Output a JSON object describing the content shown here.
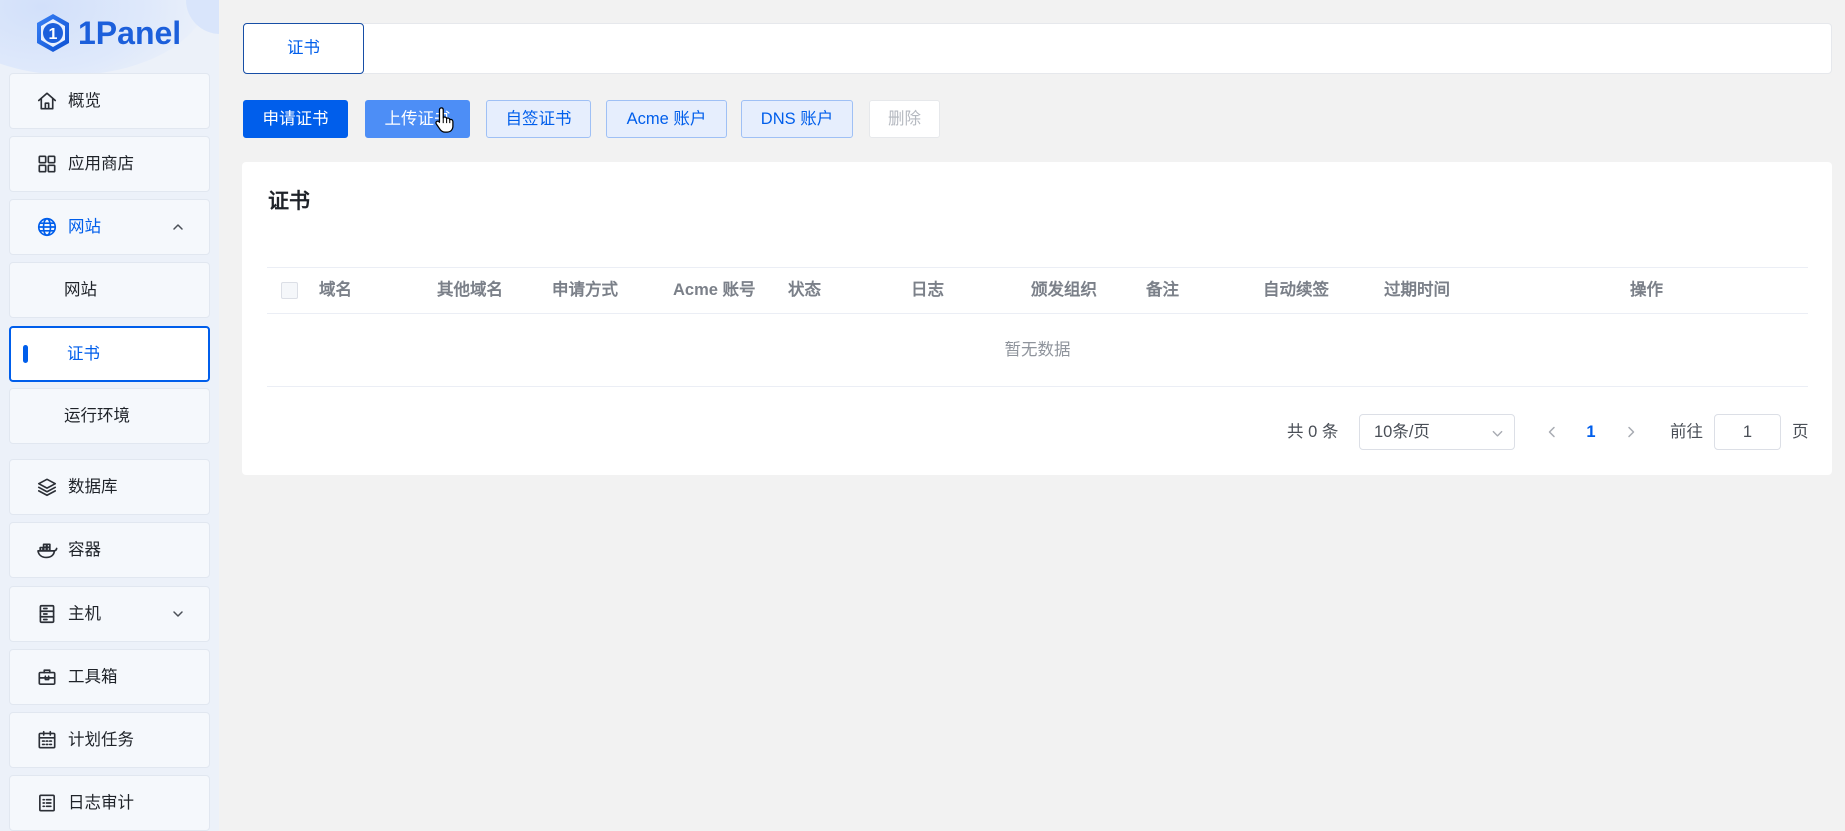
{
  "logo": {
    "mark": "1",
    "text": "1Panel"
  },
  "sidebar": {
    "items": [
      {
        "label": "概览",
        "icon": "home-icon"
      },
      {
        "label": "应用商店",
        "icon": "app-store-icon"
      },
      {
        "label": "网站",
        "icon": "globe-icon",
        "expanded": true,
        "children": [
          {
            "label": "网站"
          },
          {
            "label": "证书",
            "active": true
          },
          {
            "label": "运行环境"
          }
        ]
      },
      {
        "label": "数据库",
        "icon": "database-layers-icon"
      },
      {
        "label": "容器",
        "icon": "docker-container-icon"
      },
      {
        "label": "主机",
        "icon": "host-server-icon",
        "expanded": false
      },
      {
        "label": "工具箱",
        "icon": "toolbox-icon"
      },
      {
        "label": "计划任务",
        "icon": "calendar-icon"
      },
      {
        "label": "日志审计",
        "icon": "log-audit-icon"
      }
    ]
  },
  "tabs": [
    {
      "label": "证书",
      "active": true
    }
  ],
  "toolbar": {
    "apply_label": "申请证书",
    "upload_label": "上传证书",
    "self_signed_label": "自签证书",
    "acme_label": "Acme 账户",
    "dns_label": "DNS 账户",
    "delete_label": "删除"
  },
  "card": {
    "title": "证书"
  },
  "table": {
    "columns": [
      "域名",
      "其他域名",
      "申请方式",
      "Acme 账号",
      "状态",
      "日志",
      "颁发组织",
      "备注",
      "自动续签",
      "过期时间",
      "操作"
    ],
    "rows": [],
    "empty_text": "暂无数据"
  },
  "pagination": {
    "total_text": "共 0 条",
    "page_size": "10条/页",
    "current_page": "1",
    "goto_label": "前往",
    "goto_value": "1",
    "page_suffix": "页"
  },
  "colors": {
    "primary": "#005eeb",
    "hover_button": "#4d8ef6",
    "plain_button_bg": "#e6eefd",
    "main_background": "#f2f2f2",
    "sidebar_background": "#ecf1f9"
  }
}
